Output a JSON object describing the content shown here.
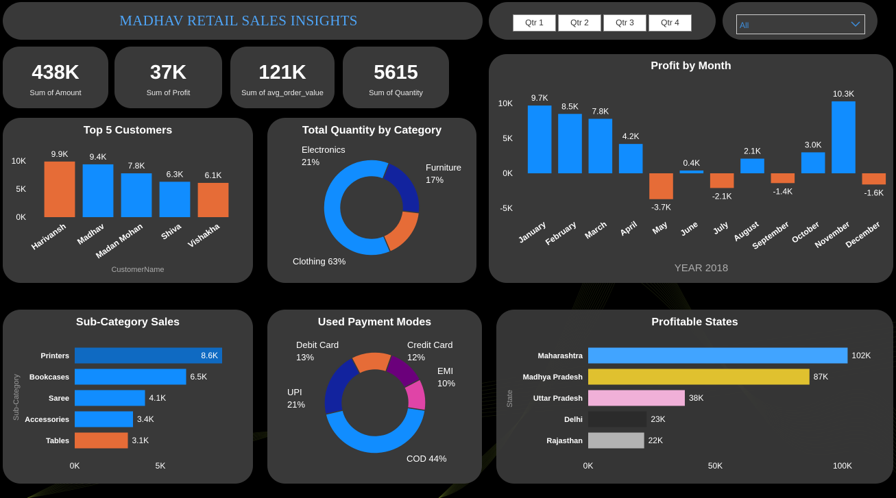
{
  "header": {
    "title": "MADHAV RETAIL SALES INSIGHTS"
  },
  "quarters": [
    "Qtr 1",
    "Qtr 2",
    "Qtr 3",
    "Qtr 4"
  ],
  "filter": {
    "value": "All"
  },
  "kpis": [
    {
      "value": "438K",
      "label": "Sum of Amount"
    },
    {
      "value": "37K",
      "label": "Sum of Profit"
    },
    {
      "value": "121K",
      "label": "Sum of avg_order_value"
    },
    {
      "value": "5615",
      "label": "Sum of Quantity"
    }
  ],
  "colors": {
    "blue": "#118dff",
    "orange": "#e66c37",
    "panel": "#393939",
    "title": "#4ea4f6"
  },
  "chart_data": [
    {
      "id": "top5",
      "type": "bar",
      "title": "Top 5 Customers",
      "xlabel": "CustomerName",
      "ylabel": "",
      "categories": [
        "Harivansh",
        "Madhav",
        "Madan Mohan",
        "Shiva",
        "Vishakha"
      ],
      "values": [
        9900,
        9400,
        7800,
        6300,
        6100
      ],
      "data_labels": [
        "9.9K",
        "9.4K",
        "7.8K",
        "6.3K",
        "6.1K"
      ],
      "bar_colors": [
        "#e66c37",
        "#118dff",
        "#118dff",
        "#118dff",
        "#e66c37"
      ],
      "yticks": [
        "0K",
        "5K",
        "10K"
      ],
      "ylim": [
        0,
        10000
      ],
      "grid": false
    },
    {
      "id": "category",
      "type": "pie",
      "title": "Total Quantity by Category",
      "labels": [
        "Clothing",
        "Electronics",
        "Furniture"
      ],
      "values": [
        63,
        21,
        17
      ],
      "display": [
        "Clothing 63%",
        "Electronics\n21%",
        "Furniture\n17%"
      ],
      "colors": [
        "#118dff",
        "#12239e",
        "#e66c37"
      ]
    },
    {
      "id": "profit",
      "type": "bar",
      "title": "Profit by Month",
      "xlabel": "YEAR 2018",
      "ylabel": "",
      "categories": [
        "January",
        "February",
        "March",
        "April",
        "May",
        "June",
        "July",
        "August",
        "September",
        "October",
        "November",
        "December"
      ],
      "values": [
        9700,
        8500,
        7800,
        4200,
        -3700,
        400,
        -2100,
        2100,
        -1400,
        3000,
        10300,
        -1600
      ],
      "data_labels": [
        "9.7K",
        "8.5K",
        "7.8K",
        "4.2K",
        "-3.7K",
        "0.4K",
        "-2.1K",
        "2.1K",
        "-1.4K",
        "3.0K",
        "10.3K",
        "-1.6K"
      ],
      "yticks": [
        "-5K",
        "0K",
        "5K",
        "10K"
      ],
      "ylim": [
        -5000,
        10000
      ],
      "grid": false
    },
    {
      "id": "subcat",
      "type": "bar",
      "orientation": "horizontal",
      "title": "Sub-Category Sales",
      "ylabel": "Sub-Category",
      "categories": [
        "Printers",
        "Bookcases",
        "Saree",
        "Accessories",
        "Tables"
      ],
      "values": [
        8600,
        6500,
        4100,
        3400,
        3100
      ],
      "data_labels": [
        "8.6K",
        "6.5K",
        "4.1K",
        "3.4K",
        "3.1K"
      ],
      "bar_colors": [
        "#0f6ac2",
        "#118dff",
        "#118dff",
        "#118dff",
        "#e66c37"
      ],
      "xticks": [
        "0K",
        "5K"
      ],
      "xlim": [
        0,
        5000
      ]
    },
    {
      "id": "payment",
      "type": "pie",
      "title": "Used Payment Modes",
      "labels": [
        "COD",
        "UPI",
        "Debit Card",
        "Credit Card",
        "EMI"
      ],
      "values": [
        44,
        21,
        13,
        12,
        10
      ],
      "display": [
        "COD 44%",
        "UPI\n21%",
        "Debit Card\n13%",
        "Credit Card\n12%",
        "EMI\n10%"
      ],
      "colors": [
        "#118dff",
        "#12239e",
        "#e66c37",
        "#6b007b",
        "#e044a7"
      ]
    },
    {
      "id": "states",
      "type": "bar",
      "orientation": "horizontal",
      "title": "Profitable States",
      "ylabel": "State",
      "categories": [
        "Maharashtra",
        "Madhya Pradesh",
        "Uttar Pradesh",
        "Delhi",
        "Rajasthan"
      ],
      "values": [
        102000,
        87000,
        38000,
        23000,
        22000
      ],
      "data_labels": [
        "102K",
        "87K",
        "38K",
        "23K",
        "22K"
      ],
      "bar_colors": [
        "#41a4ff",
        "#e0c12f",
        "#f0b0d8",
        "#2b2b2b",
        "#b3b3b3"
      ],
      "xticks": [
        "0K",
        "50K",
        "100K"
      ],
      "xlim": [
        0,
        100000
      ]
    }
  ]
}
